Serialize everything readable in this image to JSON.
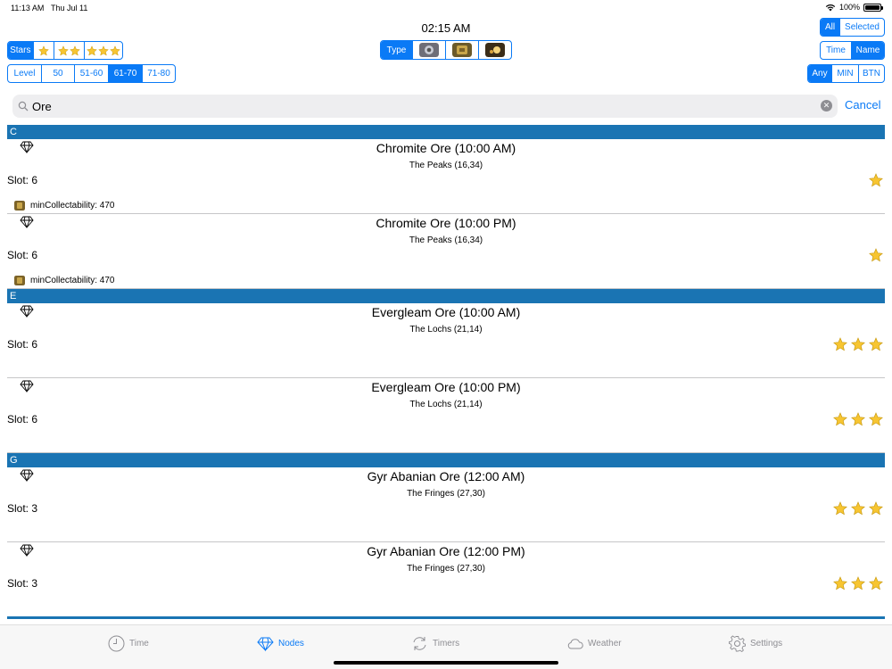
{
  "status": {
    "time": "11:13 AM",
    "date": "Thu Jul 11",
    "battery": "100%"
  },
  "clock": "02:15 AM",
  "filters": {
    "stars": {
      "label": "Stars",
      "options": [
        1,
        2,
        3
      ]
    },
    "type": {
      "label": "Type",
      "icons": [
        "mining-icon",
        "quarrying-icon",
        "botany-icon"
      ]
    },
    "level": {
      "label": "Level",
      "options": [
        "50",
        "51-60",
        "61-70",
        "71-80"
      ],
      "selected": "61-70"
    },
    "scope": {
      "options": [
        "All",
        "Selected"
      ],
      "selected": "All"
    },
    "sort": {
      "options": [
        "Time",
        "Name"
      ],
      "selected": "Name"
    },
    "job": {
      "options": [
        "Any",
        "MIN",
        "BTN"
      ],
      "selected": "Any"
    }
  },
  "search": {
    "value": "Ore",
    "cancel_label": "Cancel"
  },
  "sections": [
    {
      "letter": "C",
      "rows": [
        {
          "name": "Chromite Ore (10:00 AM)",
          "location": "The Peaks (16,34)",
          "slot": "Slot: 6",
          "stars": 1,
          "extra": "minCollectability: 470"
        },
        {
          "name": "Chromite Ore (10:00 PM)",
          "location": "The Peaks (16,34)",
          "slot": "Slot: 6",
          "stars": 1,
          "extra": "minCollectability: 470"
        }
      ]
    },
    {
      "letter": "E",
      "rows": [
        {
          "name": "Evergleam Ore (10:00 AM)",
          "location": "The Lochs (21,14)",
          "slot": "Slot: 6",
          "stars": 3,
          "extra": ""
        },
        {
          "name": "Evergleam Ore (10:00 PM)",
          "location": "The Lochs (21,14)",
          "slot": "Slot: 6",
          "stars": 3,
          "extra": ""
        }
      ]
    },
    {
      "letter": "G",
      "rows": [
        {
          "name": "Gyr Abanian Ore (12:00 AM)",
          "location": "The Fringes (27,30)",
          "slot": "Slot: 3",
          "stars": 3,
          "extra": ""
        },
        {
          "name": "Gyr Abanian Ore (12:00 PM)",
          "location": "The Fringes (27,30)",
          "slot": "Slot: 3",
          "stars": 3,
          "extra": ""
        }
      ]
    }
  ],
  "tabs": [
    {
      "label": "Time",
      "icon": "clock-icon"
    },
    {
      "label": "Nodes",
      "icon": "diamond-icon",
      "active": true
    },
    {
      "label": "Timers",
      "icon": "refresh-icon"
    },
    {
      "label": "Weather",
      "icon": "cloud-icon"
    },
    {
      "label": "Settings",
      "icon": "gear-icon"
    }
  ],
  "colors": {
    "accent": "#0a7af6",
    "section": "#1a74b3",
    "star": "#f7c531"
  }
}
